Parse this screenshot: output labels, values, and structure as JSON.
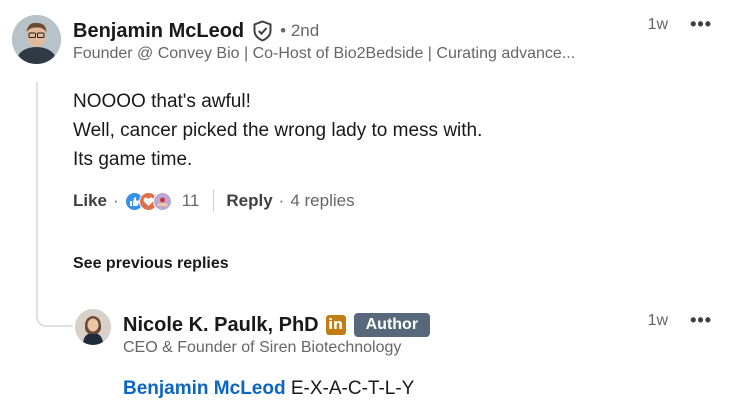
{
  "colors": {
    "text_primary": "#191919",
    "text_secondary": "#666666",
    "link_blue": "#0a66c2",
    "author_badge_bg": "#56687a",
    "linkedin_badge_bg": "#c37d16",
    "reaction_like": "#378fe9",
    "reaction_love": "#df704d",
    "reaction_support": "#bba9d1"
  },
  "comment": {
    "author_name": "Benjamin McLeod",
    "verified_icon": "shield-check-icon",
    "degree": "• 2nd",
    "headline": "Founder @ Convey Bio | Co-Host of Bio2Bedside | Curating advance...",
    "time": "1w",
    "overflow_icon": "ellipsis-icon",
    "lines": [
      "NOOOO that's awful!",
      "Well, cancer picked the wrong lady to mess with.",
      "Its game time."
    ],
    "like_label": "Like",
    "reactions": [
      "like-reaction-icon",
      "love-reaction-icon",
      "support-reaction-icon"
    ],
    "reaction_count": "11",
    "reply_label": "Reply",
    "replies_count": "4 replies"
  },
  "see_previous": "See previous replies",
  "reply": {
    "author_name": "Nicole K. Paulk, PhD",
    "linkedin_badge": "in",
    "author_badge": "Author",
    "headline": "CEO & Founder of Siren Biotechnology",
    "time": "1w",
    "mention": "Benjamin McLeod",
    "text": "E-X-A-C-T-L-Y"
  }
}
